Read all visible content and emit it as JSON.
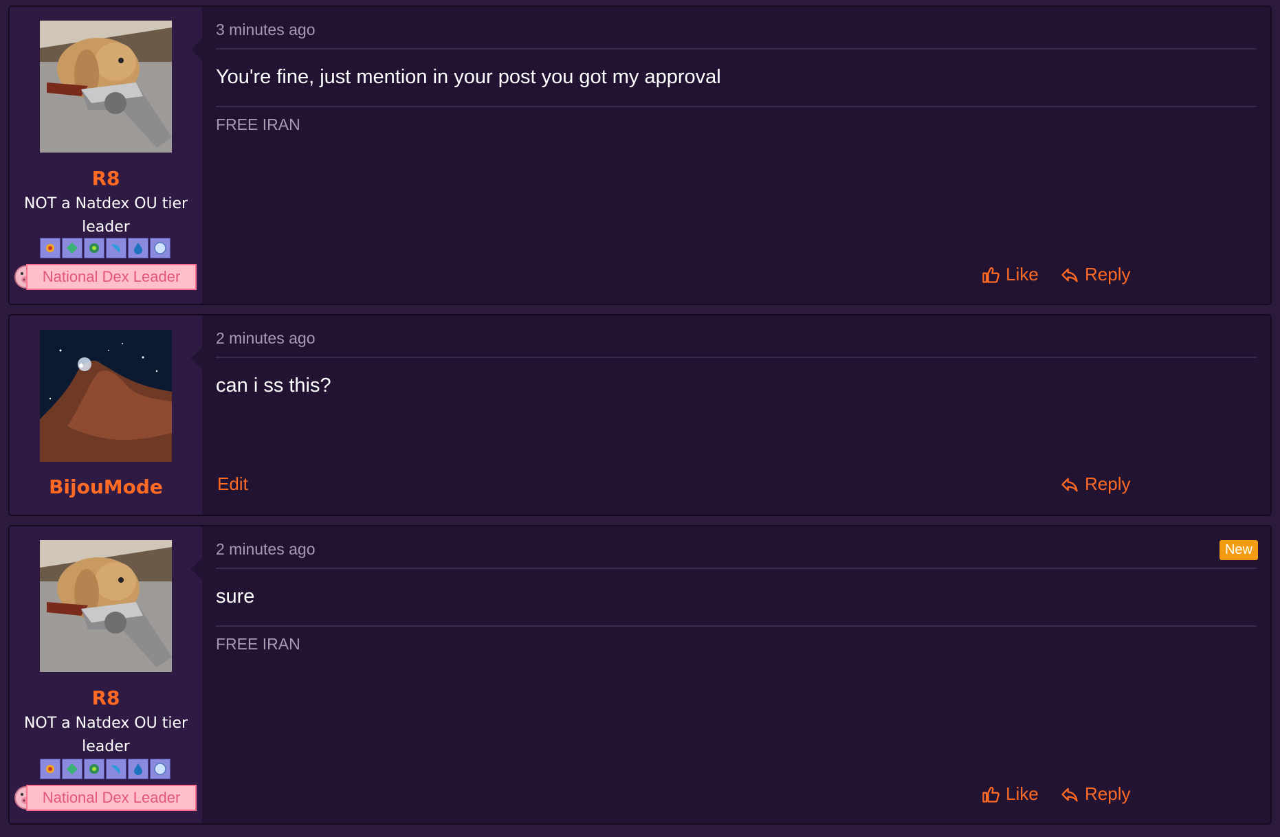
{
  "posts": [
    {
      "time": "3 minutes ago",
      "body": "You're fine, just mention in your post you got my approval",
      "signature": "FREE IRAN",
      "username": "R8",
      "user_title": "NOT a Natdex OU tier leader",
      "banner": "National Dex Leader",
      "like_label": "Like",
      "reply_label": "Reply",
      "avatar": "bunny-with-revolver"
    },
    {
      "time": "2 minutes ago",
      "body": "can i ss this?",
      "username": "BijouMode",
      "edit_label": "Edit",
      "reply_label": "Reply",
      "avatar": "horsehead-nebula"
    },
    {
      "time": "2 minutes ago",
      "body": "sure",
      "signature": "FREE IRAN",
      "username": "R8",
      "user_title": "NOT a Natdex OU tier leader",
      "banner": "National Dex Leader",
      "like_label": "Like",
      "reply_label": "Reply",
      "new_label": "New",
      "avatar": "bunny-with-revolver"
    }
  ],
  "colors": {
    "accent": "#ff6a24",
    "background": "#231333",
    "sidebar": "#2e1a42",
    "banner_bg": "#ffc0cb",
    "banner_text": "#e0567a",
    "new_badge": "#f39c12"
  },
  "icons": {
    "like": "thumbs-up-icon",
    "reply": "reply-arrow-icon"
  }
}
